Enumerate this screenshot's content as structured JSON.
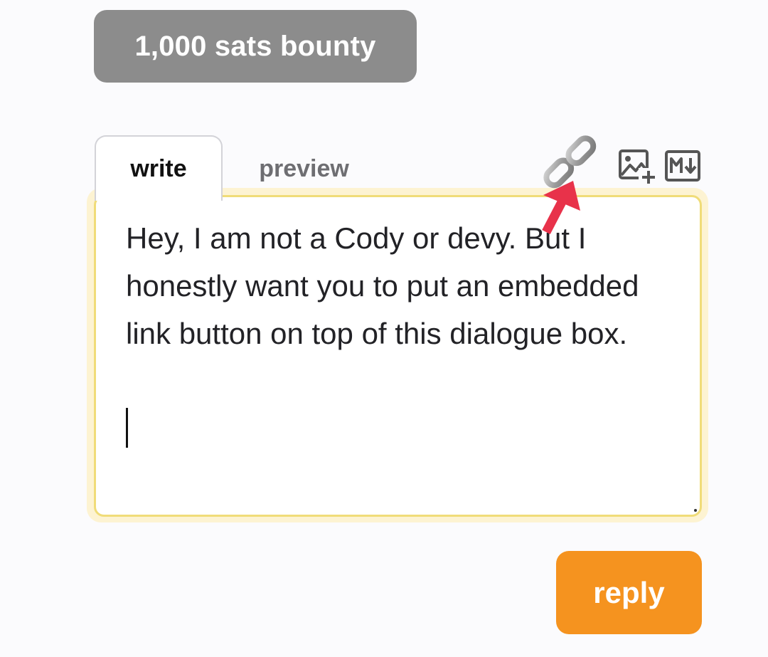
{
  "bounty": {
    "label": "1,000 sats bounty"
  },
  "editor": {
    "tabs": [
      {
        "label": "write",
        "active": true
      },
      {
        "label": "preview",
        "active": false
      }
    ],
    "content": "Hey, I am not a Cody or devy. But I honestly want you to put an embedded link button on top of this dialogue box.",
    "toolbar": {
      "icons": [
        "link-icon",
        "add-image-icon",
        "markdown-icon"
      ]
    }
  },
  "reply": {
    "label": "reply"
  },
  "colors": {
    "bounty_bg": "#8c8c8c",
    "reply_bg": "#f5931f",
    "editor_border": "#f0dc78",
    "annotation_arrow": "#e8324a"
  }
}
